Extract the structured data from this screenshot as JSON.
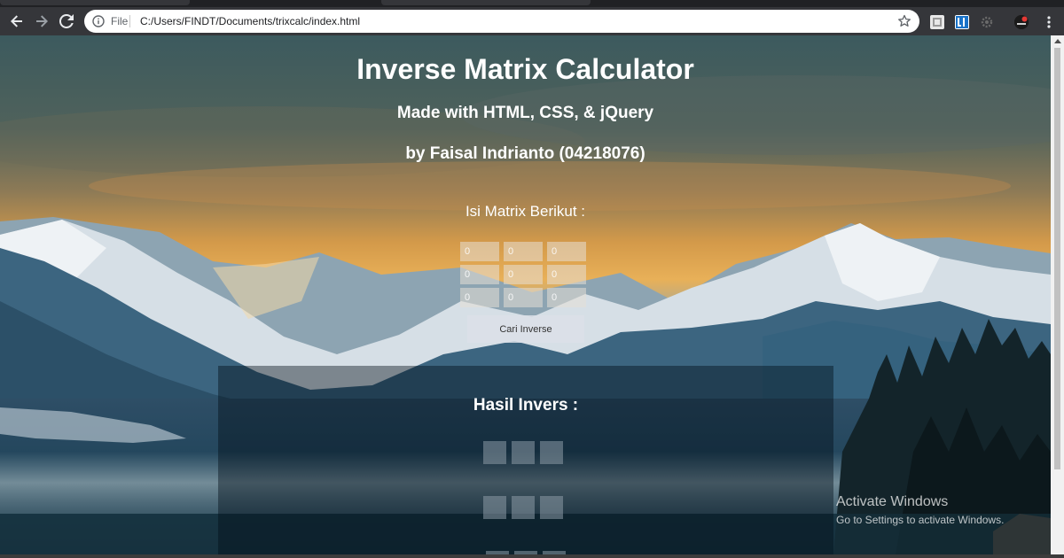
{
  "browser": {
    "address_scheme": "File",
    "address_url": "C:/Users/FINDT/Documents/trixcalc/index.html"
  },
  "page": {
    "title": "Inverse Matrix Calculator",
    "subtitle": "Made with HTML, CSS, & jQuery",
    "author": "by Faisal Indrianto (04218076)",
    "prompt": "Isi Matrix Berikut :",
    "matrix": {
      "placeholder": "0",
      "rows": [
        [
          "",
          "",
          ""
        ],
        [
          "",
          "",
          ""
        ],
        [
          "",
          "",
          ""
        ]
      ]
    },
    "calculate_label": "Cari Inverse",
    "result_title": "Hasil Invers :"
  },
  "watermark": {
    "title": "Activate Windows",
    "subtitle": "Go to Settings to activate Windows."
  },
  "icons": {
    "back": "arrow-left-icon",
    "forward": "arrow-right-icon",
    "reload": "reload-icon",
    "info": "info-icon",
    "bookmark": "star-icon",
    "menu": "vertical-dots-icon"
  },
  "colors": {
    "chrome_toolbar": "#35363a",
    "omnibox": "#ffffff",
    "page_text": "#ffffff",
    "result_panel": "#000c16"
  }
}
